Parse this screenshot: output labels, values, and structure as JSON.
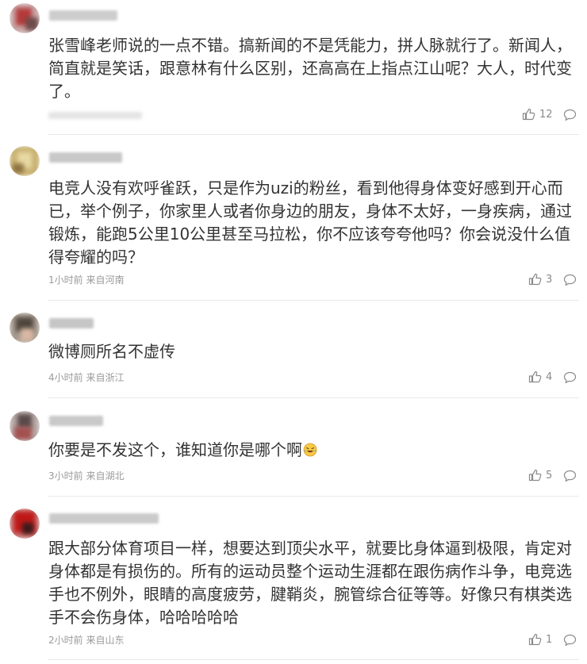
{
  "comments": [
    {
      "text": "张雪峰老师说的一点不错。搞新闻的不是凭能力，拼人脉就行了。新闻人，\n简直就是笑话，跟意林有什么区别，还高高在上指点江山呢？大人，时代变\n了。",
      "meta": "",
      "likes": "12"
    },
    {
      "text": "电竞人没有欢呼雀跃，只是作为uzi的粉丝，看到他得身体变好感到开心而\n已，举个例子，你家里人或者你身边的朋友，身体不太好，一身疾病，通过\n锻炼，能跑5公里10公里甚至马拉松，你不应该夸夸他吗？你会说没什么值\n得夸耀的吗？",
      "meta": "1小时前 来自河南",
      "likes": "3"
    },
    {
      "text": "微博厕所名不虚传",
      "meta": "4小时前 来自浙江",
      "likes": "4"
    },
    {
      "text": "你要是不发这个，谁知道你是哪个啊",
      "meta": "3小时前 来自湖北",
      "likes": "5"
    },
    {
      "text": "跟大部分体育项目一样，想要达到顶尖水平，就要比身体逼到极限，肯定对\n身体都是有损伤的。所有的运动员整个运动生涯都在跟伤病作斗争，电竞选\n手也不例外，眼睛的高度疲劳，腱鞘炎，腕管综合征等等。好像只有棋类选\n手不会伤身体，哈哈哈哈哈",
      "meta": "2小时前 来自山东",
      "likes": "1"
    }
  ],
  "icons": {
    "like": "thumbs-up-icon",
    "reply": "comment-bubble-icon",
    "emoji": "laughing-tears-emoji-icon"
  },
  "colors": {
    "text": "#333333",
    "meta": "#9a9a9a",
    "divider": "#e9e9e9"
  }
}
